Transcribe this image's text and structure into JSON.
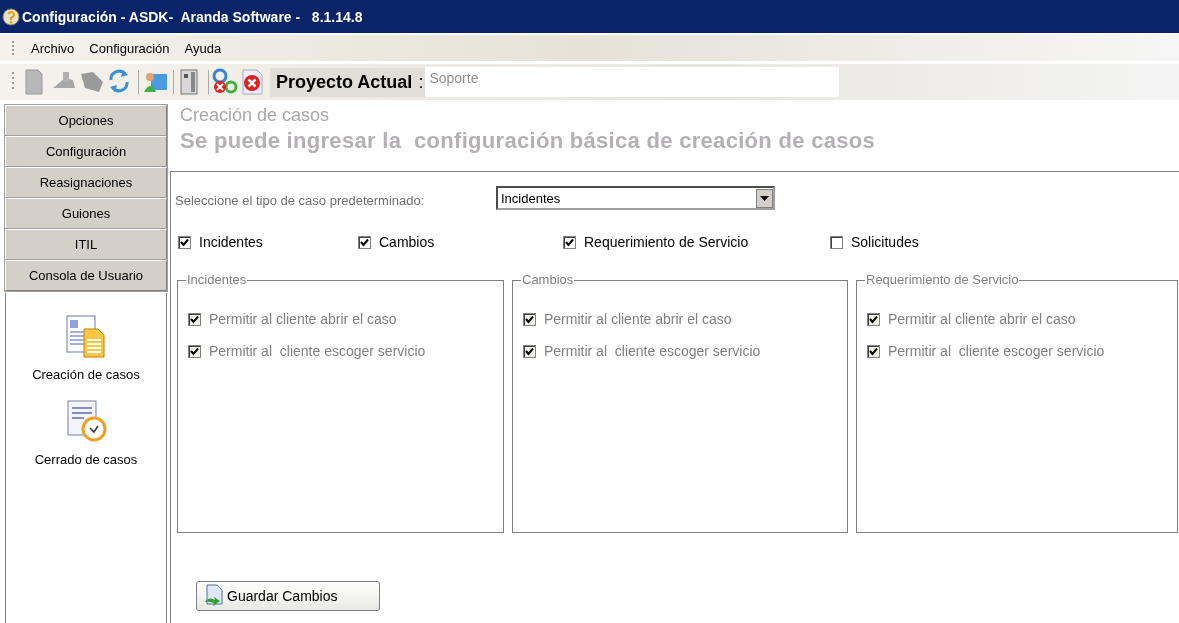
{
  "window": {
    "title": "Configuración - ASDK-  Aranda Software -   8.1.14.8"
  },
  "menu": [
    "Archivo",
    "Configuración",
    "Ayuda"
  ],
  "toolbar": {
    "project_label": "Proyecto Actual",
    "separator": ":",
    "project_value": "Soporte"
  },
  "sidebar": {
    "buttons": [
      {
        "label": "Opciones"
      },
      {
        "label": "Configuración"
      },
      {
        "label": "Reasignaciones"
      },
      {
        "label": "Guiones"
      },
      {
        "label": "ITIL"
      },
      {
        "label": "Consola de Usuario"
      }
    ],
    "items": [
      {
        "label": "Creación de casos",
        "kind": "document"
      },
      {
        "label": "Cerrado de casos",
        "kind": "clock"
      }
    ]
  },
  "header": {
    "title": "Creación de casos",
    "subtitle": "Se puede ingresar la  configuración básica de creación de casos"
  },
  "form": {
    "select_label": "Seleccione el tipo de caso predeterminado:",
    "select_value": "Incidentes",
    "case_types": [
      {
        "label": "Incidentes",
        "checked": true
      },
      {
        "label": "Cambios",
        "checked": true
      },
      {
        "label": "Requerimiento de Servicio",
        "checked": true
      },
      {
        "label": "Solicitudes",
        "checked": false
      }
    ],
    "groups": [
      {
        "title": "Incidentes",
        "disabled": true,
        "options": [
          {
            "label": "Permitir al cliente abrir el caso",
            "checked": true
          },
          {
            "label": "Permitir al  cliente escoger servicio",
            "checked": true
          }
        ]
      },
      {
        "title": "Cambios",
        "disabled": true,
        "options": [
          {
            "label": "Permitir al cliente abrir el caso",
            "checked": true
          },
          {
            "label": "Permitir al  cliente escoger servicio",
            "checked": true
          }
        ]
      },
      {
        "title": "Requerimiento de Servicio",
        "disabled": true,
        "options": [
          {
            "label": "Permitir al cliente abrir el caso",
            "checked": true
          },
          {
            "label": "Permitir al  cliente escoger servicio",
            "checked": true
          }
        ]
      }
    ],
    "save_button": "Guardar Cambios"
  }
}
